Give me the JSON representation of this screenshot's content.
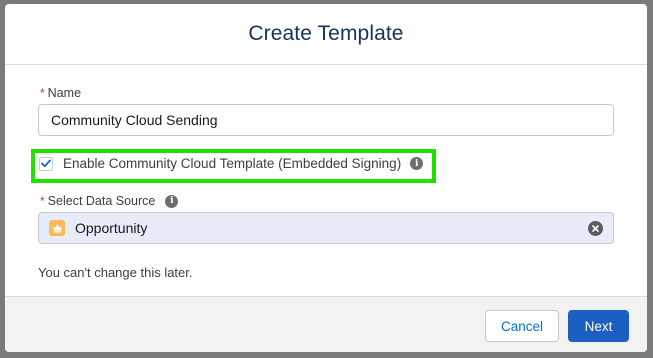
{
  "modal": {
    "title": "Create Template"
  },
  "form": {
    "name_required_marker": "*",
    "name_label": "Name",
    "name_value": "Community Cloud Sending",
    "checkbox_label": "Enable Community Cloud Template (Embedded Signing)",
    "checkbox_checked": true,
    "data_source_required_marker": "*",
    "data_source_label": "Select Data Source",
    "data_source_value": "Opportunity",
    "data_source_icon": "crown-icon",
    "helptext": "You can't change this later."
  },
  "footer": {
    "cancel_label": "Cancel",
    "next_label": "Next"
  },
  "colors": {
    "highlight": "#22e000",
    "brand_button": "#1b5fc1",
    "title": "#16325c",
    "opportunity_icon": "#fcb95b"
  }
}
